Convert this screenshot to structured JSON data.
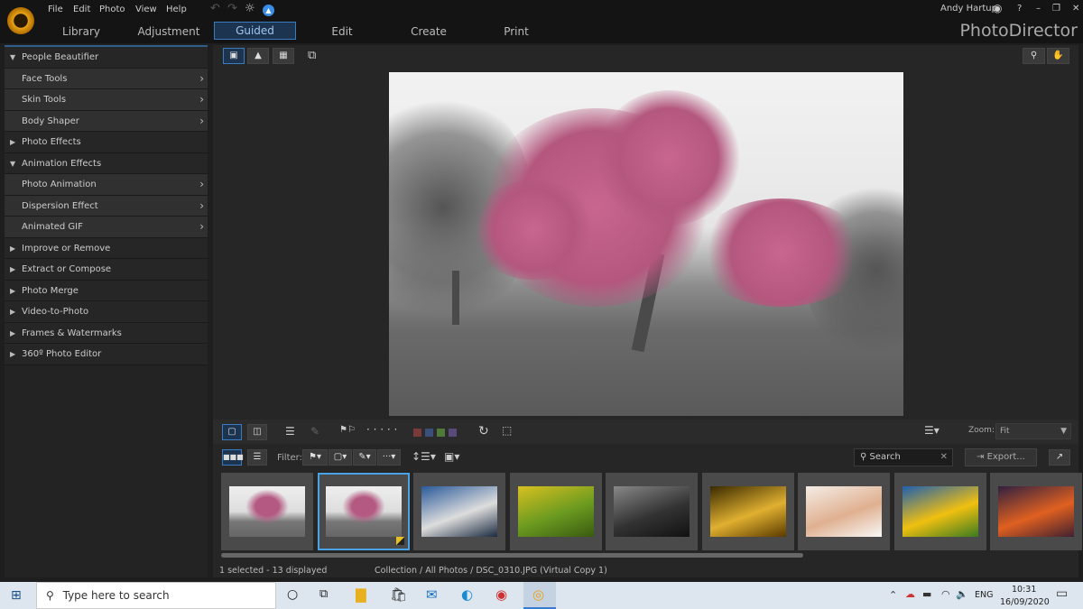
{
  "app": {
    "brand": "PhotoDirector",
    "user": "Andy Hartup"
  },
  "menu": [
    "File",
    "Edit",
    "Photo",
    "View",
    "Help"
  ],
  "tabs": [
    "Library",
    "Adjustment",
    "Guided",
    "Edit",
    "Create",
    "Print"
  ],
  "active_tab": "Guided",
  "sidebar": [
    {
      "label": "People Beautifier",
      "type": "group",
      "expanded": true
    },
    {
      "label": "Face Tools",
      "type": "sub"
    },
    {
      "label": "Skin Tools",
      "type": "sub"
    },
    {
      "label": "Body Shaper",
      "type": "sub"
    },
    {
      "label": "Photo Effects",
      "type": "group",
      "expanded": false
    },
    {
      "label": "Animation Effects",
      "type": "group",
      "expanded": true
    },
    {
      "label": "Photo Animation",
      "type": "sub"
    },
    {
      "label": "Dispersion Effect",
      "type": "sub"
    },
    {
      "label": "Animated GIF",
      "type": "sub"
    },
    {
      "label": "Improve or Remove",
      "type": "group",
      "expanded": false
    },
    {
      "label": "Extract or Compose",
      "type": "group",
      "expanded": false
    },
    {
      "label": "Photo Merge",
      "type": "group",
      "expanded": false
    },
    {
      "label": "Video-to-Photo",
      "type": "group",
      "expanded": false
    },
    {
      "label": "Frames & Watermarks",
      "type": "group",
      "expanded": false
    },
    {
      "label": "360º Photo Editor",
      "type": "group",
      "expanded": false
    }
  ],
  "toolbar": {
    "zoom_label": "Zoom:",
    "zoom_value": "Fit",
    "filter_label": "Filter:",
    "search_placeholder": "Search",
    "export_label": "Export...",
    "color_labels": [
      "#7a3a3a",
      "#3a4f7a",
      "#4f7a3a",
      "#5a4a7a"
    ]
  },
  "thumbnails": [
    {
      "name": "cherry tree original",
      "colors": [
        "#e8e8e8",
        "#888",
        "#b45a82"
      ]
    },
    {
      "name": "cherry tree virtual copy",
      "colors": [
        "#e8e8e8",
        "#888",
        "#b45a82"
      ],
      "selected": true
    },
    {
      "name": "mountain lake",
      "colors": [
        "#2a5a9a",
        "#ddd",
        "#1a2a40"
      ]
    },
    {
      "name": "bicycle yellow",
      "colors": [
        "#d8c020",
        "#6a9a20",
        "#3a5a10"
      ]
    },
    {
      "name": "dark sea",
      "colors": [
        "#888",
        "#333",
        "#111"
      ]
    },
    {
      "name": "spiral staircase",
      "colors": [
        "#3a2a00",
        "#e0b030",
        "#5a3a00"
      ]
    },
    {
      "name": "smiling woman",
      "colors": [
        "#f4ede6",
        "#e0b090",
        "#f8f8f8"
      ]
    },
    {
      "name": "sunflower",
      "colors": [
        "#1f5fb0",
        "#f0c010",
        "#3a7a20"
      ]
    },
    {
      "name": "sunset",
      "colors": [
        "#302040",
        "#e06020",
        "#402030"
      ]
    }
  ],
  "status": {
    "selection": "1 selected - 13 displayed",
    "path": "Collection / All Photos / DSC_0310.JPG (Virtual Copy 1)"
  },
  "taskbar": {
    "search_placeholder": "Type here to search",
    "lang": "ENG",
    "time": "10:31",
    "date": "16/09/2020"
  }
}
